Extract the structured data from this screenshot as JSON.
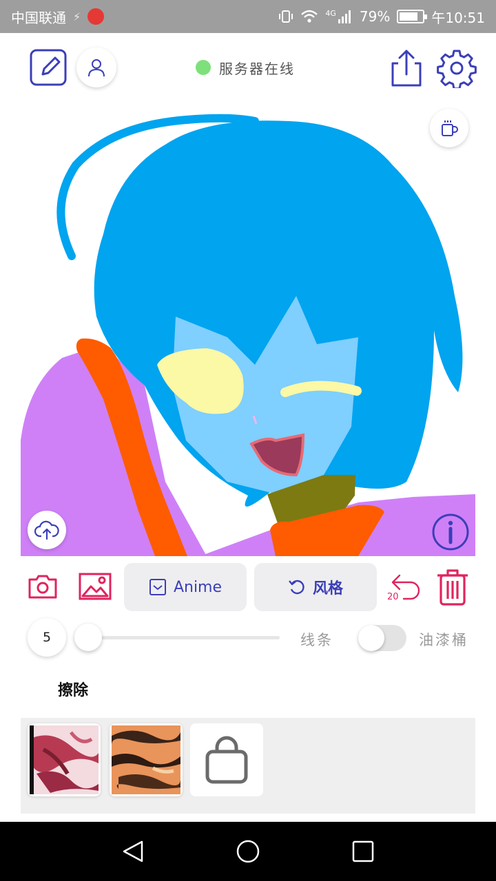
{
  "status_bar": {
    "carrier": "中国联通",
    "network_label": "4G",
    "battery_percent": "79%",
    "battery_level": 0.79,
    "time": "午10:51"
  },
  "toolbar": {
    "server_status": "服务器在线",
    "server_status_color": "#7ee07a",
    "icons": [
      "edit-icon",
      "user-icon",
      "share-icon",
      "settings-icon",
      "coffee-icon"
    ]
  },
  "canvas": {
    "upload_icon": "cloud-upload-icon",
    "info_icon": "info-icon"
  },
  "controls": {
    "model_label": "Anime",
    "style_label": "风格",
    "undo_count": "20",
    "accent_color": "#3b3fb8",
    "danger_color": "#e0245e"
  },
  "brush": {
    "size": "5",
    "size_level": 0.0,
    "line_label": "线条",
    "bucket_label": "油漆桶",
    "bucket_on": false
  },
  "erase_label": "擦除",
  "style_tray": {
    "items": [
      "style-thumb-red",
      "style-thumb-tiger",
      "shop-bag"
    ]
  },
  "navbar": {
    "icons": [
      "back-icon",
      "home-icon",
      "recents-icon"
    ]
  }
}
